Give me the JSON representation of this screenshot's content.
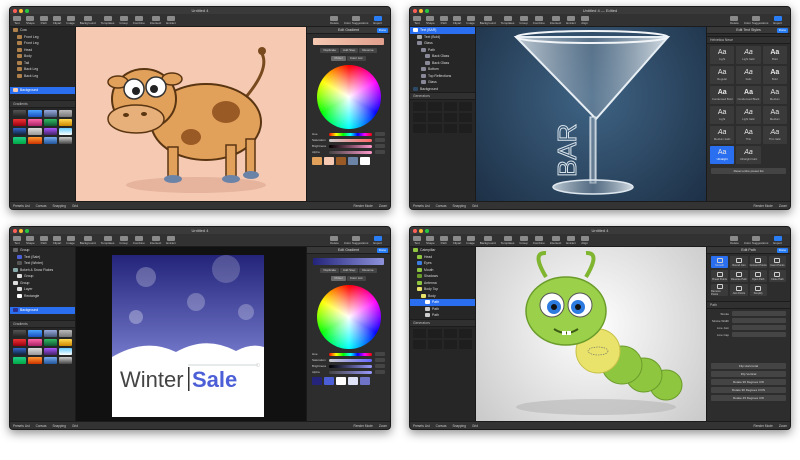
{
  "windows": {
    "w1": {
      "title": "Untitled 4",
      "toolbar": [
        "Text",
        "Shape",
        "Path",
        "Clipart",
        "Image",
        "Background",
        "Templates",
        "Group",
        "Combine",
        "Intersect",
        "Extract",
        "Delete",
        "Color Suggestions",
        "Export"
      ],
      "layers": [
        "Cow",
        "Front Leg",
        "Front Leg",
        "Head",
        "Body",
        "Tail",
        "Back Leg",
        "Back Leg",
        "Background"
      ],
      "panel_title": "Edit Gradient",
      "done": "Done",
      "tabs": [
        "Duplicate",
        "Add Step",
        "Reverse"
      ],
      "color_tabs": [
        "Picker",
        "Color List"
      ],
      "sliders": [
        "Hue",
        "Saturation",
        "Brightness",
        "Alpha"
      ],
      "gradients_label": "Gradients",
      "status": [
        "Presets List",
        "Canvas",
        "Snapping",
        "Grid",
        "Render Mode",
        "Zoom"
      ]
    },
    "w2": {
      "title": "Untitled 4 — Edited",
      "toolbar": [
        "Text",
        "Shape",
        "Path",
        "Clipart",
        "Image",
        "Background",
        "Templates",
        "Group",
        "Combine",
        "Intersect",
        "Extract",
        "Align",
        "Delete",
        "Color Suggestions",
        "Export"
      ],
      "layers": [
        "Text (BAR)",
        "Text (Bold)",
        "Glass",
        "Path",
        "Back Glass",
        "Back Glass",
        "Bottom",
        "Top Reflections",
        "Glass",
        "Background"
      ],
      "generators_label": "Generators",
      "canvas_text": "BAR",
      "panel_title": "Edit Text Styles",
      "done": "Done",
      "font_section": "Helvetica Neue",
      "fonts": [
        "Light",
        "Light Italic",
        "Bold",
        "Regular",
        "Italic",
        "Bold",
        "Condensed Bold",
        "Condensed Black",
        "Medium",
        "Light",
        "Light Italic",
        "Medium",
        "Medium Italic",
        "Thin",
        "Thin Italic",
        "Ultralight",
        "Ultralight Italic"
      ],
      "sample": "Aa",
      "reset": "Reset entire preset list",
      "status": [
        "Presets List",
        "Canvas",
        "Snapping",
        "Grid",
        "Render Mode",
        "Zoom"
      ]
    },
    "w3": {
      "title": "Untitled 4",
      "toolbar": [
        "Text",
        "Shape",
        "Path",
        "Clipart",
        "Image",
        "Background",
        "Templates",
        "Group",
        "Combine",
        "Intersect",
        "Extract",
        "Delete",
        "Color Suggestions",
        "Export"
      ],
      "layers": [
        "Group",
        "Text (Sale)",
        "Text (Winter)",
        "Bokeh & Snow Flakes",
        "Group",
        "Group",
        "Layer",
        "Rectangle",
        "Background"
      ],
      "canvas_word1": "Winter",
      "canvas_word2": "Sale",
      "panel_title": "Edit Gradient",
      "done": "Done",
      "tabs": [
        "Duplicate",
        "Add Step",
        "Reverse"
      ],
      "color_tabs": [
        "Picker",
        "Color List"
      ],
      "sliders": [
        "Hue",
        "Saturation",
        "Brightness",
        "Alpha"
      ],
      "gradients_label": "Gradients",
      "status": [
        "Presets List",
        "Canvas",
        "Snapping",
        "Grid",
        "Render Mode",
        "Zoom"
      ]
    },
    "w4": {
      "title": "Untitled 4",
      "toolbar": [
        "Text",
        "Shape",
        "Path",
        "Clipart",
        "Image",
        "Background",
        "Templates",
        "Group",
        "Combine",
        "Intersect",
        "Extract",
        "Align",
        "Delete",
        "Color Suggestions",
        "Export"
      ],
      "layers": [
        "Caterpillar",
        "Head",
        "Eyes",
        "Mouth",
        "Shadows",
        "Antenna",
        "Body Top",
        "Body",
        "Path",
        "Path",
        "Path"
      ],
      "generators_label": "Generators",
      "panel_title": "Edit Path",
      "done": "Done",
      "effects": [
        "Smooth",
        "Round Join",
        "Convert Points",
        "Insert Points",
        "Break Points",
        "Reverse Path",
        "Open Path",
        "Close Path",
        "Remove Points",
        "Join Points",
        "Simplify"
      ],
      "path_label": "Path",
      "props": [
        "Stroke",
        "Stroke Width",
        "Line Join",
        "Line Cap"
      ],
      "buttons": [
        "Flip Horizontal",
        "Flip Vertical",
        "Rotate 90 Degrees CW",
        "Rotate 90 Degrees CCW",
        "Rotate 45 Degrees CW"
      ],
      "status": [
        "Presets List",
        "Canvas",
        "Snapping",
        "Grid",
        "Render Mode",
        "Zoom"
      ]
    }
  },
  "colors": {
    "accent": "#2a6ff0",
    "chrome": "#2b2b2b",
    "cow_bg": "#f6c9b2",
    "bar_bg": "#2c4a66",
    "winter_bg": "#2e2f8f",
    "sale_blue": "#4c5fd6",
    "caterpillar_green": "#8fc63f"
  },
  "icons": [
    "close-light",
    "minimize-light",
    "zoom-light",
    "eye-icon",
    "lock-icon",
    "gear-icon"
  ]
}
